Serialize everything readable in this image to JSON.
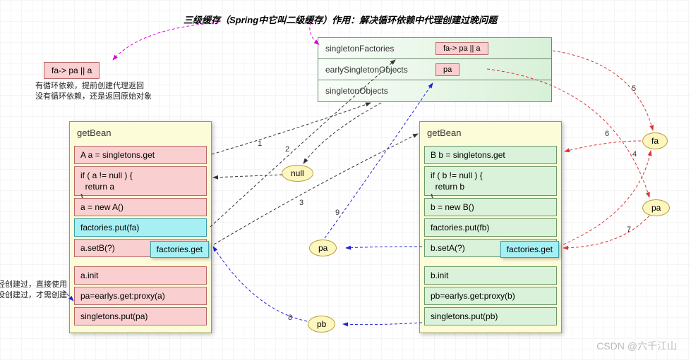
{
  "title": "三级缓存（Spring中它叫二级缓存）作用：解决循环依赖中代理创建过晚问题",
  "leftNote": {
    "badge": "fa-> pa || a",
    "line1": "有循环依赖，提前创建代理返回",
    "line2": "没有循环依赖，还是返回原始对象"
  },
  "cache": {
    "rows": [
      {
        "label": "singletonFactories",
        "badge": "fa-> pa || a"
      },
      {
        "label": "earlySingletonObjects",
        "badge": "pa"
      },
      {
        "label": "singletonObjects",
        "badge": ""
      }
    ]
  },
  "panelA": {
    "header": "getBean",
    "rows": {
      "r1": "A a = singletons.get",
      "r2": "if ( a != null ) {\n  return a\n}",
      "r3": "a = new A()",
      "r4": "factories.put(fa)",
      "r5": "a.setB(?)",
      "r5_overlay": "factories.get",
      "r6": "a.init",
      "r7": "pa=earlys.get:proxy(a)",
      "r8": "singletons.put(pa)"
    }
  },
  "panelB": {
    "header": "getBean",
    "rows": {
      "r1": "B b = singletons.get",
      "r2": "if ( b != null ) {\n  return b\n}",
      "r3": "b = new B()",
      "r4": "factories.put(fb)",
      "r5": "b.setA(?)",
      "r5_overlay": "factories.get",
      "r6": "b.init",
      "r7": "pb=earlys.get:proxy(b)",
      "r8": "singletons.put(pb)"
    }
  },
  "bottomNote": {
    "line1": "代理已经创建过，直接使用",
    "line2": "没创建过，才需创建"
  },
  "ellipses": {
    "null": "null",
    "pa_mid": "pa",
    "pb": "pb",
    "fa": "fa",
    "pa_right": "pa"
  },
  "labels": {
    "l1": "1",
    "l2": "2",
    "l3": "3",
    "l4": "4",
    "l5": "5",
    "l6": "6",
    "l7": "7",
    "l8": "8",
    "l9": "9"
  },
  "watermark": "CSDN @六千江山"
}
